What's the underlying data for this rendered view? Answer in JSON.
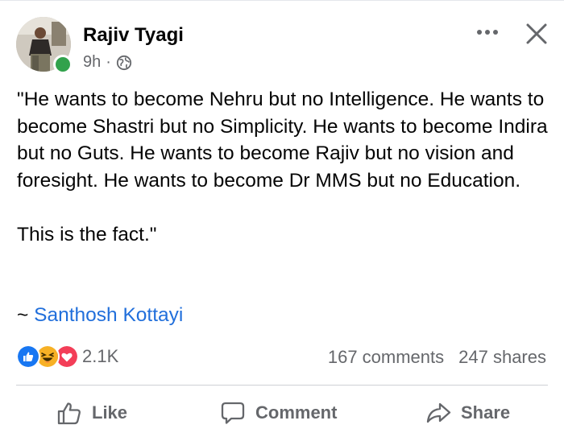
{
  "post": {
    "author": "Rajiv Tyagi",
    "time": "9h",
    "separator": "·",
    "paragraphs": [
      "\"He wants to become Nehru but no Intelligence. He wants to become Shastri but no Simplicity. He wants to become Indira but no Guts. He wants to become Rajiv but no vision and foresight. He wants to become Dr MMS but no Education.",
      "This is the fact.\""
    ],
    "attribution_prefix": "~ ",
    "attribution_name": "Santhosh Kottayi"
  },
  "engagement": {
    "reaction_count": "2.1K",
    "comments": "167 comments",
    "shares": "247 shares"
  },
  "actions": {
    "like": "Like",
    "comment": "Comment",
    "share": "Share"
  },
  "colors": {
    "link": "#216fdb",
    "online": "#31a24c",
    "like_reaction": "#1877f2",
    "love_reaction": "#f33e58",
    "haha_reaction": "#f7b125"
  },
  "icons": [
    "globe-icon",
    "more-options-icon",
    "close-icon",
    "like-reaction-icon",
    "haha-reaction-icon",
    "love-reaction-icon",
    "thumbs-up-icon",
    "comment-icon",
    "share-icon"
  ]
}
